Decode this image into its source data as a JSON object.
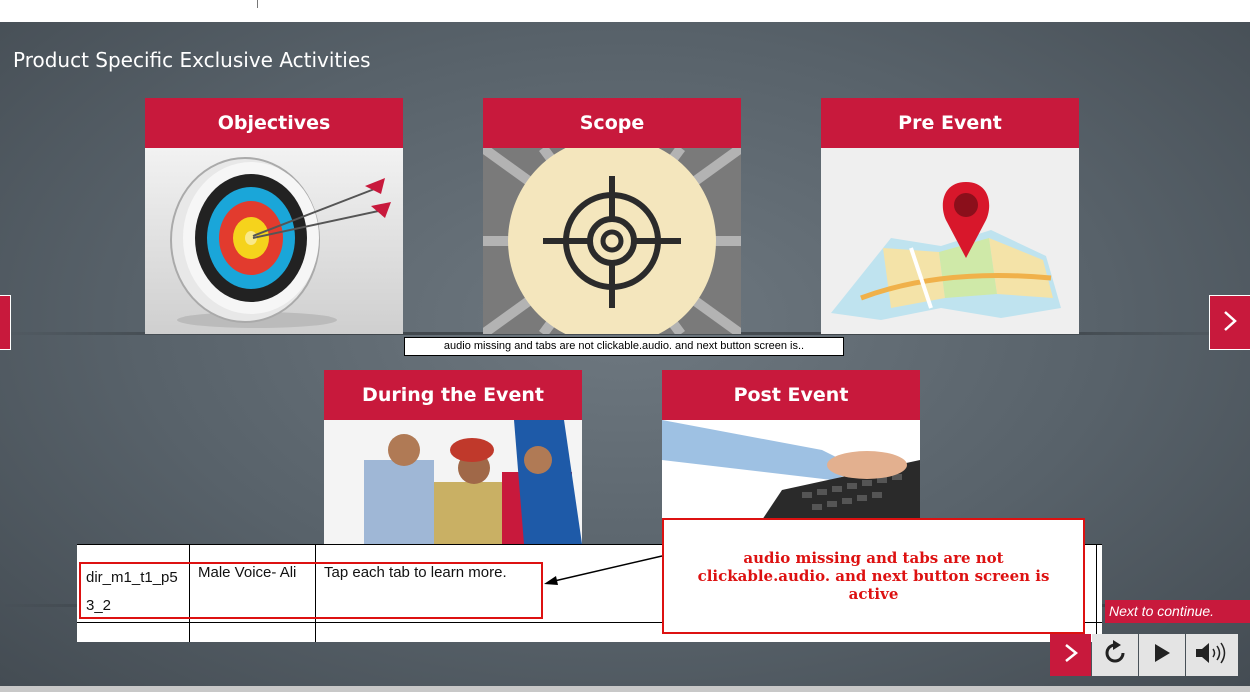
{
  "page": {
    "title": "Product Specific Exclusive Activities"
  },
  "cards": [
    {
      "label": "Objectives",
      "image": "target-arrows-image"
    },
    {
      "label": "Scope",
      "image": "crosshair-image"
    },
    {
      "label": "Pre Event",
      "image": "map-pin-image"
    },
    {
      "label": "During the Event",
      "image": "people-laptop-image"
    },
    {
      "label": "Post Event",
      "image": "keyboard-typing-image"
    }
  ],
  "caption": "audio missing and tabs are not clickable.audio. and next button screen is..",
  "review_table": {
    "row": [
      "dir_m1_t1_p53_2",
      "Male Voice- Ali",
      "Tap each tab to learn more."
    ]
  },
  "callout": "audio missing and tabs are not clickable.audio. and next button screen is active",
  "controls": {
    "next_label": "Next to continue.",
    "buttons": [
      "next-icon",
      "replay-icon",
      "play-icon",
      "volume-icon"
    ]
  },
  "colors": {
    "accent": "#c8193c",
    "annotation": "#dd1111"
  }
}
